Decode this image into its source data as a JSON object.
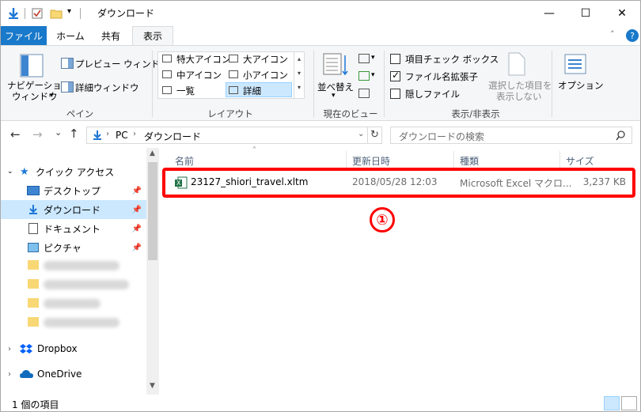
{
  "window": {
    "title": "ダウンロード",
    "minimize": "—",
    "maximize": "☐",
    "close": "✕",
    "help": "?"
  },
  "tabs": {
    "file": "ファイル",
    "home": "ホーム",
    "share": "共有",
    "view": "表示"
  },
  "ribbon": {
    "pane": {
      "nav_pane": "ナビゲーション",
      "nav_pane2": "ウィンドウ",
      "preview": "プレビュー ウィンドウ",
      "details": "詳細ウィンドウ",
      "label": "ペイン"
    },
    "layout": {
      "xl_icons": "特大アイコン",
      "l_icons": "大アイコン",
      "m_icons": "中アイコン",
      "s_icons": "小アイコン",
      "list": "一覧",
      "details": "詳細",
      "label": "レイアウト"
    },
    "current_view": {
      "sort": "並べ替え",
      "label": "現在のビュー"
    },
    "show_hide": {
      "item_checkbox": "項目チェック ボックス",
      "file_ext": "ファイル名拡張子",
      "hidden_items": "隠しファイル",
      "hide_selected": "選択した項目を",
      "hide_selected2": "表示しない",
      "label": "表示/非表示"
    },
    "options": {
      "label": "オプション"
    }
  },
  "navigation": {
    "back": "←",
    "forward": "→",
    "recent": "⌄",
    "up": "↑",
    "breadcrumb_pc": "PC",
    "breadcrumb_downloads": "ダウンロード",
    "refresh": "↻",
    "search_placeholder": "ダウンロードの検索"
  },
  "sidebar": {
    "quick_access": "クイック アクセス",
    "desktop": "デスクトップ",
    "downloads": "ダウンロード",
    "documents": "ドキュメント",
    "pictures": "ピクチャ",
    "dropbox": "Dropbox",
    "onedrive": "OneDrive"
  },
  "columns": {
    "name": "名前",
    "modified": "更新日時",
    "type": "種類",
    "size": "サイズ"
  },
  "files": [
    {
      "name": "23127_shiori_travel.xltm",
      "modified": "2018/05/28 12:03",
      "type": "Microsoft Excel マクロ...",
      "size": "3,237 KB"
    }
  ],
  "annotation": {
    "number": "①"
  },
  "status": {
    "count": "1 個の項目"
  },
  "colors": {
    "file_tab": "#1979ca",
    "selected": "#cce8ff",
    "highlight": "#ff0000"
  }
}
